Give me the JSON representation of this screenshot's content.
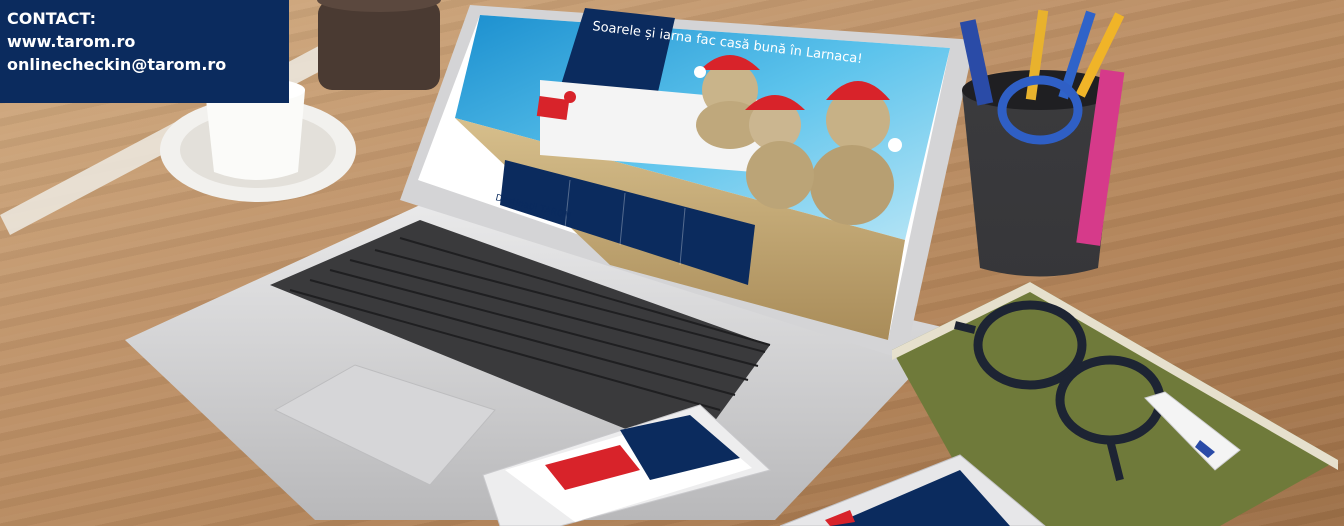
{
  "contact": {
    "heading": "CONTACT:",
    "website": "www.tarom.ro",
    "email": "onlinecheckin@tarom.ro"
  },
  "laptop_screen": {
    "hero_title": "Soarele și iarna fac casă bună în Larnaca!",
    "section_title": "Destinații TAROM"
  },
  "colors": {
    "brand_blue": "#0b2b5e",
    "accent_red": "#d8232a",
    "white": "#ffffff"
  },
  "icons": [
    "pen-holder-icon",
    "eyeglasses-icon",
    "usb-drive-icon",
    "coffee-cup-icon",
    "snowman-icon"
  ]
}
